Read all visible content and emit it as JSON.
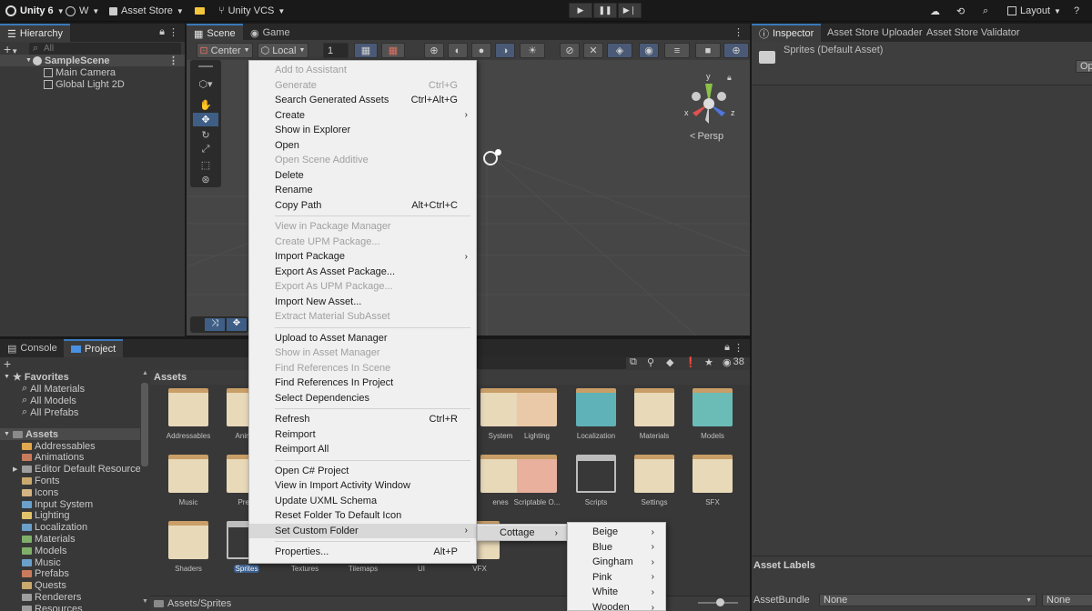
{
  "topbar": {
    "app": "Unity 6",
    "account": "W",
    "asset_store": "Asset Store",
    "vcs": "Unity VCS",
    "layout": "Layout"
  },
  "hierarchy": {
    "tab": "Hierarchy",
    "search_placeholder": "All",
    "scene": "SampleScene",
    "objects": [
      "Main Camera",
      "Global Light 2D"
    ]
  },
  "scene": {
    "tabs": [
      "Scene",
      "Game"
    ],
    "pivot": "Center",
    "space": "Local",
    "grid_value": "1",
    "persp": "Persp",
    "gizmo_axes": {
      "x": "x",
      "y": "y",
      "z": "z"
    }
  },
  "inspector": {
    "tabs": [
      "Inspector",
      "Asset Store Uploader",
      "Asset Store Validator"
    ],
    "asset_title": "Sprites (Default Asset)",
    "open_button": "Op",
    "labels_header": "Asset Labels",
    "bundle_label": "AssetBundle",
    "bundle_value": "None",
    "bundle_variant": "None"
  },
  "bottom": {
    "tabs": [
      "Console",
      "Project"
    ],
    "assets_header": "Assets",
    "breadcrumb": "Assets/Sprites",
    "hidden_count": "38"
  },
  "project_tree": {
    "favorites": "Favorites",
    "favorite_items": [
      "All Materials",
      "All Models",
      "All Prefabs"
    ],
    "assets_root": "Assets",
    "folders": [
      "Addressables",
      "Animations",
      "Editor Default Resources",
      "Fonts",
      "Icons",
      "Input System",
      "Lighting",
      "Localization",
      "Materials",
      "Models",
      "Music",
      "Prefabs",
      "Quests",
      "Renderers",
      "Resources"
    ]
  },
  "tiles": [
    [
      "Addressables",
      "Animat",
      "System",
      "Lighting",
      "Localization",
      "Materials",
      "Models"
    ],
    [
      "Music",
      "Prefa",
      "enes",
      "Scriptable O...",
      "Scripts",
      "Settings",
      "SFX"
    ],
    [
      "Shaders",
      "Sprites",
      "Textures",
      "Tilemaps",
      "UI",
      "VFX"
    ]
  ],
  "context_menu": {
    "items": [
      {
        "label": "Add to Assistant",
        "disabled": true
      },
      {
        "label": "Generate",
        "shortcut": "Ctrl+G",
        "disabled": true
      },
      {
        "label": "Search Generated Assets",
        "shortcut": "Ctrl+Alt+G"
      },
      {
        "label": "Create",
        "submenu": true
      },
      {
        "label": "Show in Explorer"
      },
      {
        "label": "Open"
      },
      {
        "label": "Open Scene Additive",
        "disabled": true
      },
      {
        "label": "Delete"
      },
      {
        "label": "Rename"
      },
      {
        "label": "Copy Path",
        "shortcut": "Alt+Ctrl+C"
      },
      {
        "label": "View in Package Manager",
        "disabled": true
      },
      {
        "label": "Create UPM Package...",
        "disabled": true
      },
      {
        "label": "Import Package",
        "submenu": true
      },
      {
        "label": "Export As Asset Package..."
      },
      {
        "label": "Export As UPM Package...",
        "disabled": true
      },
      {
        "label": "Import New Asset..."
      },
      {
        "label": "Extract Material SubAsset",
        "disabled": true
      },
      {
        "label": "Upload to Asset Manager"
      },
      {
        "label": "Show in Asset Manager",
        "disabled": true
      },
      {
        "label": "Find References In Scene",
        "disabled": true
      },
      {
        "label": "Find References In Project"
      },
      {
        "label": "Select Dependencies"
      },
      {
        "label": "Refresh",
        "shortcut": "Ctrl+R"
      },
      {
        "label": "Reimport"
      },
      {
        "label": "Reimport All"
      },
      {
        "label": "Open C# Project"
      },
      {
        "label": "View in Import Activity Window"
      },
      {
        "label": "Update UXML Schema"
      },
      {
        "label": "Reset Folder To Default Icon"
      },
      {
        "label": "Set Custom Folder",
        "submenu": true,
        "highlighted": true
      },
      {
        "label": "Properties...",
        "shortcut": "Alt+P"
      }
    ],
    "submenu1": [
      "Cottage"
    ],
    "submenu2": [
      "Beige",
      "Blue",
      "Gingham",
      "Pink",
      "White",
      "Wooden"
    ]
  },
  "colors": {
    "accent": "#3a79bb",
    "selection": "#3b5f8f",
    "menu_bg": "#f0f0f0"
  }
}
